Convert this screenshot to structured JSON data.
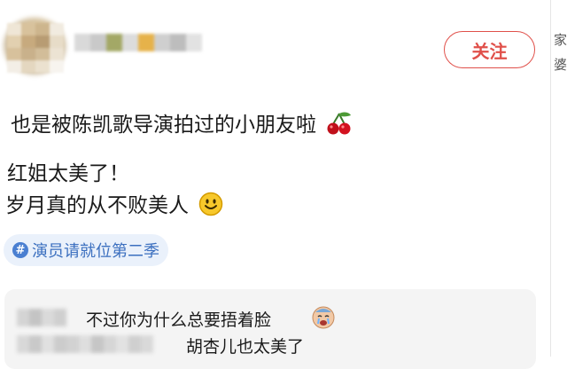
{
  "post": {
    "follow_label": "关注",
    "line1": "也是被陈凯歌导演拍过的小朋友啦",
    "line2": "红姐太美了！",
    "line3": "岁月真的从不败美人",
    "topic": "演员请就位第二季",
    "topic_icon": "#"
  },
  "comments": [
    {
      "text": "不过你为什么总要捂着脸"
    },
    {
      "text": "胡杏儿也太美了"
    }
  ],
  "side": {
    "c1": "家",
    "c2": "婆"
  },
  "colors": {
    "accent": "#e0504a",
    "topic_text": "#3b6fbf",
    "topic_bg": "#eaf1fb"
  },
  "icons": [
    "cherry-emoji-icon",
    "smile-emoji-icon",
    "crying-emoji-icon",
    "topic-hash-icon"
  ]
}
